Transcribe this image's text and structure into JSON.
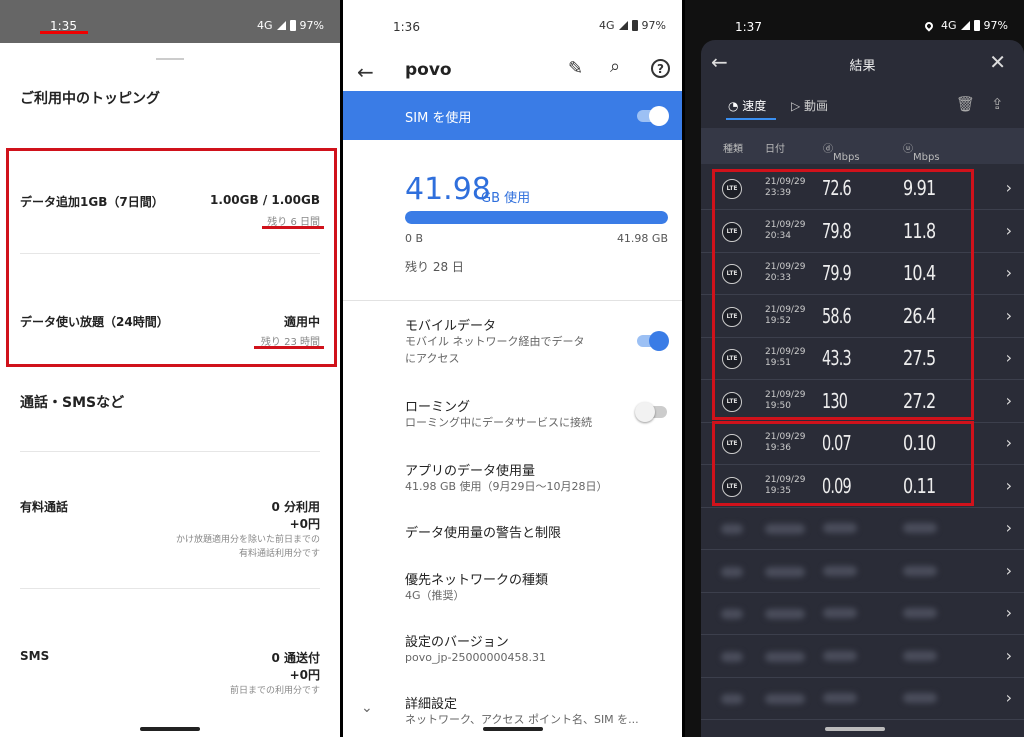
{
  "status": {
    "p1_time": "1:35",
    "p2_time": "1:36",
    "p3_time": "1:37",
    "network": "4G",
    "battery": "97%"
  },
  "p1": {
    "title": "ご利用中のトッピング",
    "rows": [
      {
        "label": "データ追加1GB（7日間）",
        "value": "1.00GB / 1.00GB",
        "sub": "残り 6 日間"
      },
      {
        "label": "データ使い放題（24時間）",
        "value": "適用中",
        "sub": "残り 23 時間"
      }
    ],
    "section2": "通話・SMSなど",
    "call": {
      "label": "有料通話",
      "value": "0 分利用",
      "yen": "+0円",
      "note1": "かけ放題適用分を除いた前日までの",
      "note2": "有料通話利用分です"
    },
    "sms": {
      "label": "SMS",
      "value": "0 通送付",
      "yen": "+0円",
      "note": "前日までの利用分です"
    }
  },
  "p2": {
    "app_title": "povo",
    "sim_label": "SIM を使用",
    "usage_number": "41.98",
    "usage_unit": "GB 使用",
    "usage_fraction": 1.0,
    "bar_min": "0 B",
    "bar_max": "41.98 GB",
    "remaining": "残り 28 日",
    "settings": [
      {
        "title": "モバイルデータ",
        "sub1": "モバイル ネットワーク経由でデータ",
        "sub2": "にアクセス"
      },
      {
        "title": "ローミング",
        "sub1": "ローミング中にデータサービスに接続",
        "sub2": ""
      },
      {
        "title": "アプリのデータ使用量",
        "sub1": "41.98 GB 使用（9月29日〜10月28日）",
        "sub2": ""
      },
      {
        "title": "データ使用量の警告と制限",
        "sub1": "",
        "sub2": ""
      },
      {
        "title": "優先ネットワークの種類",
        "sub1": "4G（推奨）",
        "sub2": ""
      },
      {
        "title": "設定のバージョン",
        "sub1": "povo_jp-25000000458.31",
        "sub2": ""
      },
      {
        "title": "詳細設定",
        "sub1": "ネットワーク、アクセス ポイント名、SIM を...",
        "sub2": ""
      }
    ]
  },
  "p3": {
    "title": "結果",
    "tab_speed": "速度",
    "tab_video": "動画",
    "col_type": "種類",
    "col_date": "日付",
    "col_down": "Mbps",
    "col_up": "Mbps",
    "badge": "LTE",
    "results": [
      {
        "date1": "21/09/29",
        "date2": "23:39",
        "down": "72.6",
        "up": "9.91"
      },
      {
        "date1": "21/09/29",
        "date2": "20:34",
        "down": "79.8",
        "up": "11.8"
      },
      {
        "date1": "21/09/29",
        "date2": "20:33",
        "down": "79.9",
        "up": "10.4"
      },
      {
        "date1": "21/09/29",
        "date2": "19:52",
        "down": "58.6",
        "up": "26.4"
      },
      {
        "date1": "21/09/29",
        "date2": "19:51",
        "down": "43.3",
        "up": "27.5"
      },
      {
        "date1": "21/09/29",
        "date2": "19:50",
        "down": "130",
        "up": "27.2"
      },
      {
        "date1": "21/09/29",
        "date2": "19:36",
        "down": "0.07",
        "up": "0.10"
      },
      {
        "date1": "21/09/29",
        "date2": "19:35",
        "down": "0.09",
        "up": "0.11"
      }
    ],
    "blurred_rows": 5
  }
}
